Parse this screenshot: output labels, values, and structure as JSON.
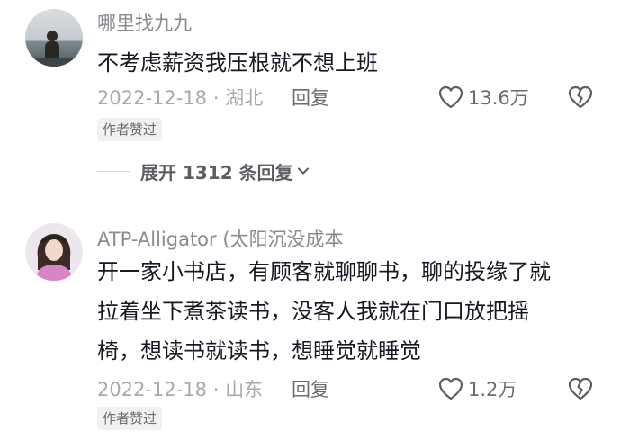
{
  "comments": [
    {
      "username": "哪里找九九",
      "lines": [
        "不考虑薪资我压根就不想上班"
      ],
      "date_location": "2022-12-18 · 湖北",
      "reply_label": "回复",
      "like_count": "13.6万",
      "badge": "作者赞过",
      "expand_label": "展开 1312 条回复"
    },
    {
      "username": "ATP-Alligator (太阳沉没成本",
      "lines": [
        "开一家小书店，有顾客就聊聊书，聊的投缘了就",
        "拉着坐下煮茶读书，没客人我就在门口放把摇",
        "椅，想读书就读书，想睡觉就睡觉"
      ],
      "date_location": "2022-12-18 · 山东",
      "reply_label": "回复",
      "like_count": "1.2万",
      "badge": "作者赞过"
    }
  ],
  "icons": {
    "like": "heart-outline-icon",
    "dislike": "broken-heart-icon",
    "expand": "chevron-down-icon"
  }
}
